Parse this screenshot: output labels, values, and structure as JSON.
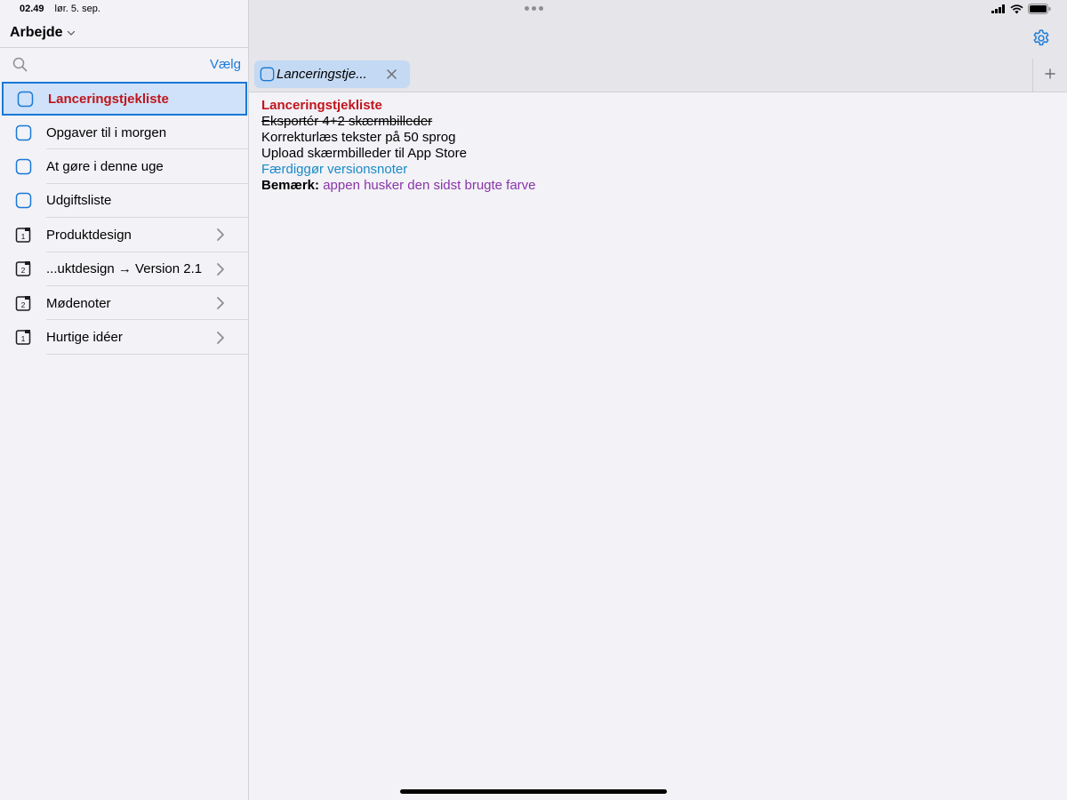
{
  "status_bar": {
    "time": "02.49",
    "date": "lør. 5. sep."
  },
  "sidebar": {
    "folder": "Arbejde",
    "search_placeholder": "",
    "select_label": "Vælg",
    "items": [
      {
        "label": "Lanceringstjekliste",
        "icon": "document-icon",
        "selected": true
      },
      {
        "label": "Opgaver til i morgen",
        "icon": "document-icon"
      },
      {
        "label": "At gøre i denne uge",
        "icon": "document-icon"
      },
      {
        "label": "Udgiftsliste",
        "icon": "document-icon"
      },
      {
        "label": "Produktdesign",
        "icon": "folder-1-icon",
        "badge": "1",
        "has_chevron": true
      },
      {
        "label": "...uktdesign → Version 2.1",
        "icon": "folder-2-icon",
        "badge": "2",
        "has_chevron": true
      },
      {
        "label": "Mødenoter",
        "icon": "folder-2-icon",
        "badge": "2",
        "has_chevron": true
      },
      {
        "label": "Hurtige idéer",
        "icon": "folder-1-icon",
        "badge": "1",
        "has_chevron": true
      }
    ]
  },
  "tabs": [
    {
      "label": "Lanceringstje...",
      "active": true
    }
  ],
  "editor": {
    "title": "Lanceringstjekliste",
    "lines": [
      "Eksportér 4+2 skærmbilleder",
      "Korrekturlæs tekster på 50 sprog",
      "Upload skærmbilleder til App Store",
      "Færdiggør versionsnoter"
    ],
    "note_label": "Bemærk:",
    "note_text": "appen husker den sidst brugte farve"
  },
  "colors": {
    "accent": "#1e7bd6",
    "title_red": "#c0151c",
    "link_blue": "#1a8ac6",
    "note_purple": "#8a35a8",
    "selection_bg": "#cfe2f9"
  }
}
